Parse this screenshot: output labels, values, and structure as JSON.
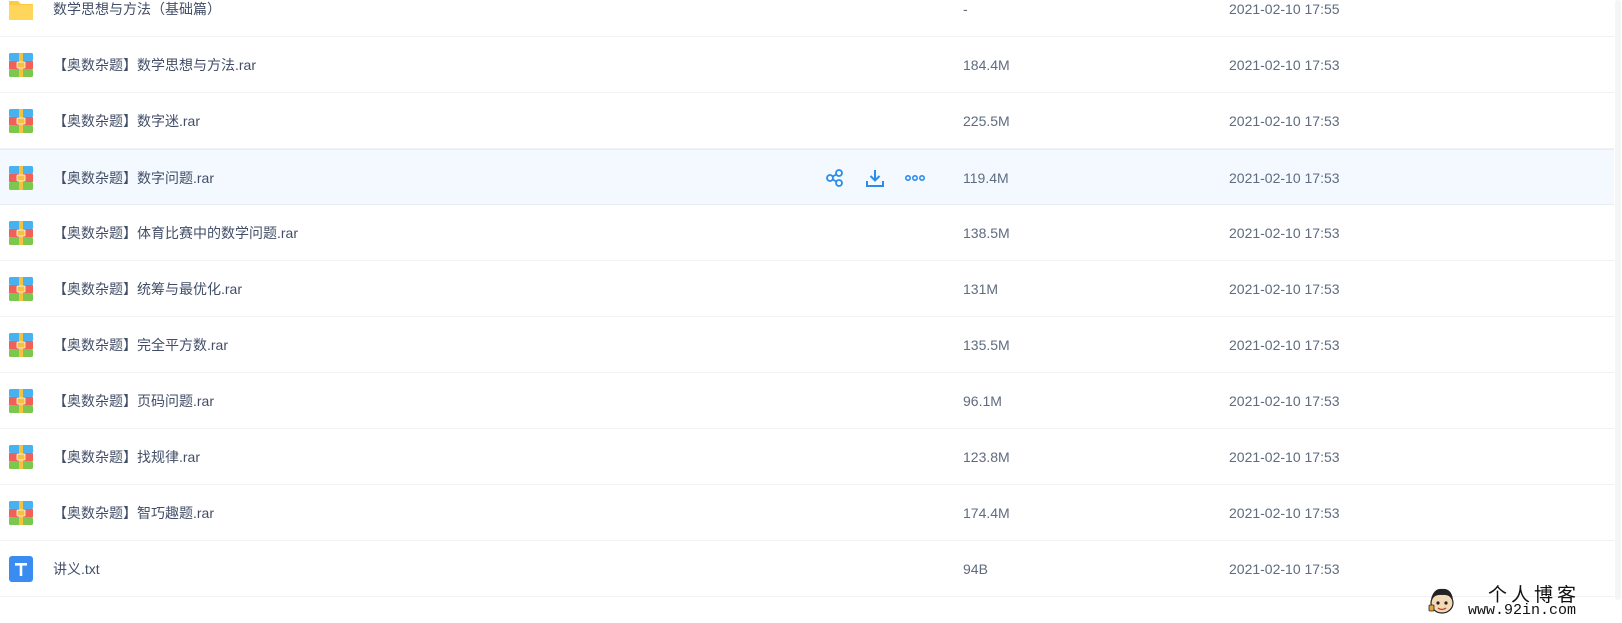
{
  "files": [
    {
      "name": "数学思想与方法（基础篇）",
      "size": "-",
      "date": "2021-02-10 17:55",
      "icon": "folder-icon"
    },
    {
      "name": "【奥数杂题】数学思想与方法.rar",
      "size": "184.4M",
      "date": "2021-02-10 17:53",
      "icon": "rar-archive-icon"
    },
    {
      "name": "【奥数杂题】数字迷.rar",
      "size": "225.5M",
      "date": "2021-02-10 17:53",
      "icon": "rar-archive-icon"
    },
    {
      "name": "【奥数杂题】数字问题.rar",
      "size": "119.4M",
      "date": "2021-02-10 17:53",
      "icon": "rar-archive-icon"
    },
    {
      "name": "【奥数杂题】体育比赛中的数学问题.rar",
      "size": "138.5M",
      "date": "2021-02-10 17:53",
      "icon": "rar-archive-icon"
    },
    {
      "name": "【奥数杂题】统筹与最优化.rar",
      "size": "131M",
      "date": "2021-02-10 17:53",
      "icon": "rar-archive-icon"
    },
    {
      "name": "【奥数杂题】完全平方数.rar",
      "size": "135.5M",
      "date": "2021-02-10 17:53",
      "icon": "rar-archive-icon"
    },
    {
      "name": "【奥数杂题】页码问题.rar",
      "size": "96.1M",
      "date": "2021-02-10 17:53",
      "icon": "rar-archive-icon"
    },
    {
      "name": "【奥数杂题】找规律.rar",
      "size": "123.8M",
      "date": "2021-02-10 17:53",
      "icon": "rar-archive-icon"
    },
    {
      "name": "【奥数杂题】智巧趣题.rar",
      "size": "174.4M",
      "date": "2021-02-10 17:53",
      "icon": "rar-archive-icon"
    },
    {
      "name": "讲义.txt",
      "size": "94B",
      "date": "2021-02-10 17:53",
      "icon": "text-file-icon"
    }
  ],
  "hovered_row_actions": [
    "share-icon",
    "download-icon",
    "more-icon"
  ],
  "colors": {
    "action_blue": "#2b8ceb",
    "folder_yellow": "#ffc940",
    "text_file_blue": "#3a8cf0",
    "hover_row_bg": "#f3f9fe"
  },
  "watermark": {
    "title": "个人博客",
    "url": "www.92in.com"
  }
}
